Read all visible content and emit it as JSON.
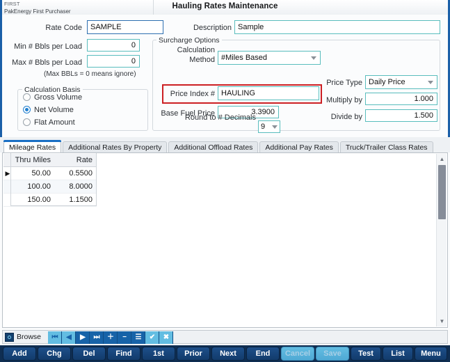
{
  "titlebar": {
    "app_code": "FIRST",
    "app_name": "PakEnergy First Purchaser",
    "title": "Hauling Rates Maintenance"
  },
  "form": {
    "rate_code_label": "Rate Code",
    "rate_code_value": "SAMPLE",
    "description_label": "Description",
    "description_value": "Sample",
    "min_bbls_label": "Min # Bbls per Load",
    "min_bbls_value": "0",
    "max_bbls_label": "Max # Bbls per Load",
    "max_bbls_value": "0",
    "bbls_note": "(Max BBLs = 0 means ignore)",
    "calc_basis": {
      "title": "Calculation Basis",
      "options": [
        {
          "label": "Gross Volume",
          "selected": false
        },
        {
          "label": "Net Volume",
          "selected": true
        },
        {
          "label": "Flat Amount",
          "selected": false
        }
      ]
    },
    "surcharge": {
      "title": "Surcharge Options",
      "calc_method_label_line1": "Calculation",
      "calc_method_label_line2": "Method",
      "calc_method_value": "#Miles Based",
      "price_index_label": "Price Index #",
      "price_index_value": "HAULING",
      "base_fuel_price_label": "Base Fuel Price",
      "base_fuel_price_value": "3.3900",
      "round_decimals_label": "Round to # Decimals",
      "round_decimals_value": "9",
      "price_type_label": "Price Type",
      "price_type_value": "Daily Price",
      "multiply_by_label": "Multiply by",
      "multiply_by_value": "1.000",
      "divide_by_label": "Divide by",
      "divide_by_value": "1.500"
    }
  },
  "tabs": [
    {
      "label": "Mileage Rates",
      "active": true
    },
    {
      "label": "Additional Rates By Property",
      "active": false
    },
    {
      "label": "Additional Offload Rates",
      "active": false
    },
    {
      "label": "Additional Pay Rates",
      "active": false
    },
    {
      "label": "Truck/Trailer Class Rates",
      "active": false
    }
  ],
  "grid": {
    "columns": [
      "Thru Miles",
      "Rate"
    ],
    "rows": [
      {
        "indicator": "▶",
        "thru_miles": "50.00",
        "rate": "0.5500"
      },
      {
        "indicator": "",
        "thru_miles": "100.00",
        "rate": "8.0000"
      },
      {
        "indicator": "",
        "thru_miles": "150.00",
        "rate": "1.1500"
      }
    ]
  },
  "browse_bar": {
    "icon": "browse-icon",
    "label": "Browse",
    "nav_buttons": [
      {
        "name": "first-record",
        "glyph": "⏮",
        "enabled": false
      },
      {
        "name": "prior-record",
        "glyph": "◀",
        "enabled": false
      },
      {
        "name": "next-record",
        "glyph": "▶",
        "enabled": true
      },
      {
        "name": "last-record",
        "glyph": "⏭",
        "enabled": true
      },
      {
        "name": "add-record",
        "glyph": "＋",
        "enabled": true
      },
      {
        "name": "delete-record",
        "glyph": "−",
        "enabled": true
      },
      {
        "name": "list-records",
        "glyph": "☰",
        "enabled": true
      },
      {
        "name": "accept-record",
        "glyph": "✔",
        "enabled": false
      },
      {
        "name": "cancel-record",
        "glyph": "✖",
        "enabled": false
      }
    ]
  },
  "buttons": [
    {
      "name": "add-button",
      "label": "Add",
      "accel": "A",
      "enabled": true
    },
    {
      "name": "chg-button",
      "label": "Chg",
      "accel": "C",
      "enabled": true
    },
    {
      "name": "del-button",
      "label": "Del",
      "accel": "D",
      "enabled": true
    },
    {
      "name": "find-button",
      "label": "Find",
      "accel": "F",
      "enabled": true
    },
    {
      "name": "first-button",
      "label": "1st",
      "accel": "1",
      "enabled": true
    },
    {
      "name": "prior-button",
      "label": "Prior",
      "accel": "P",
      "enabled": true
    },
    {
      "name": "next-button",
      "label": "Next",
      "accel": "N",
      "enabled": true
    },
    {
      "name": "end-button",
      "label": "End",
      "accel": "E",
      "enabled": true
    },
    {
      "name": "cancel-button",
      "label": "Cancel",
      "accel": "",
      "enabled": false
    },
    {
      "name": "save-button",
      "label": "Save",
      "accel": "",
      "enabled": false
    },
    {
      "name": "test-button",
      "label": "Test",
      "accel": "T",
      "enabled": true
    },
    {
      "name": "list-button",
      "label": "List",
      "accel": "L",
      "enabled": true
    },
    {
      "name": "menu-button",
      "label": "Menu",
      "accel": "M",
      "enabled": true
    }
  ],
  "colors": {
    "accent_blue": "#1a5fa8",
    "field_border": "#59bdbd",
    "highlight_red": "#cc1f23",
    "button_bar": "#0f2e52"
  }
}
